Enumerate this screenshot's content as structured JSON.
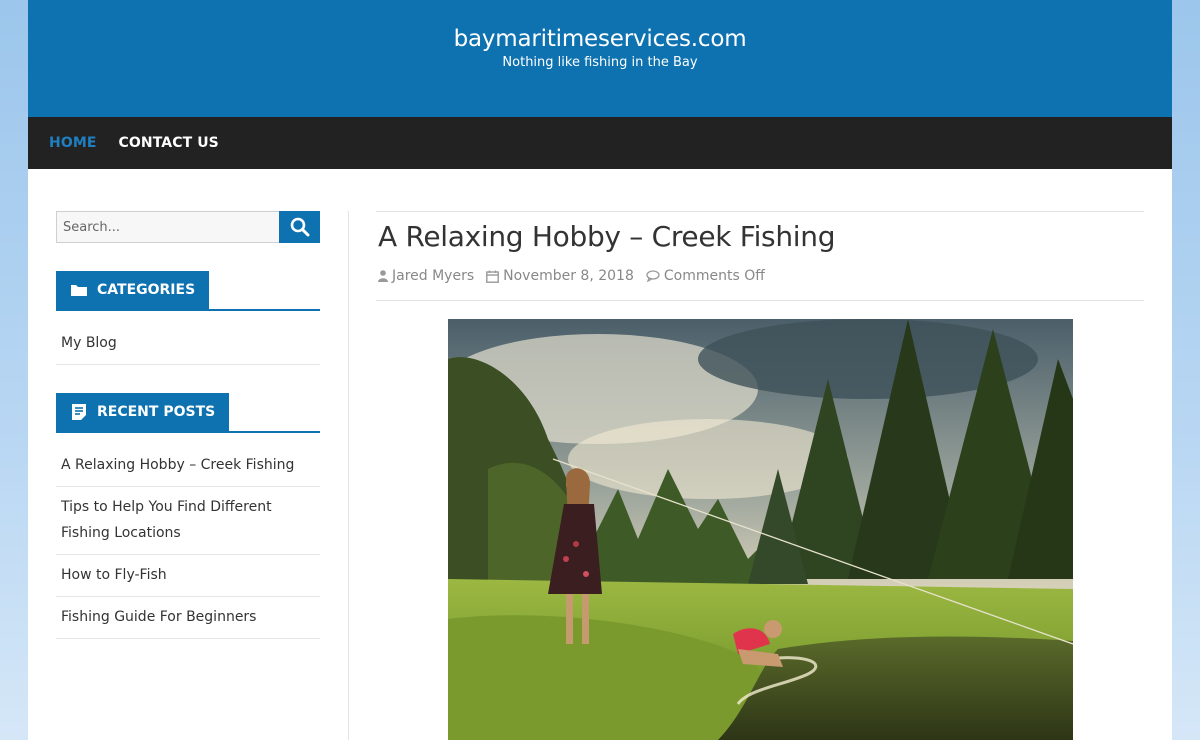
{
  "site": {
    "title": "baymaritimeservices.com",
    "description": "Nothing like fishing in the Bay"
  },
  "nav": {
    "items": [
      {
        "label": "HOME",
        "active": true
      },
      {
        "label": "CONTACT US",
        "active": false
      }
    ]
  },
  "search": {
    "placeholder": "Search...",
    "value": "",
    "button_icon": "search-icon"
  },
  "widgets": {
    "categories": {
      "title": "CATEGORIES",
      "icon": "folder-icon",
      "items": [
        "My Blog"
      ]
    },
    "recent_posts": {
      "title": "RECENT POSTS",
      "icon": "document-icon",
      "items": [
        "A Relaxing Hobby – Creek Fishing",
        "Tips to Help You Find Different Fishing Locations",
        "How to Fly-Fish",
        "Fishing Guide For Beginners"
      ]
    }
  },
  "post": {
    "title": "A Relaxing Hobby – Creek Fishing",
    "author": "Jared Myers",
    "date": "November 8, 2018",
    "comments": "Comments Off",
    "image_subject": "two girls fishing at a creek with evergreen trees"
  },
  "colors": {
    "accent": "#0e72b1",
    "nav_bg": "#222222",
    "nav_active": "#1f7fc0"
  }
}
